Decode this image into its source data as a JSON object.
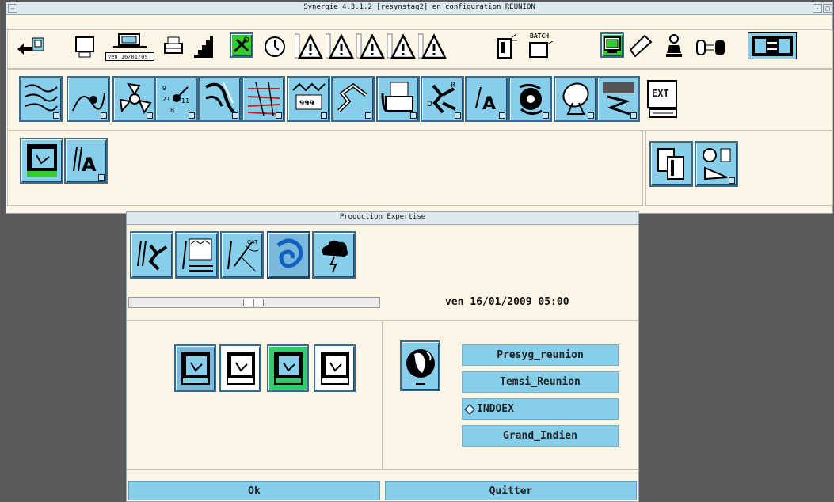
{
  "main_window": {
    "title": "Synergie 4.3.1.2 [resynstag2] en configuration REUNION",
    "date_display": "ven 16/01/09",
    "batch_label": "BATCH",
    "exit_label": "EXT",
    "toolbar_icons": [
      "back-icon",
      "screen-icon",
      "calendar-date-icon",
      "print-icon",
      "profile-icon",
      "green-tools-icon",
      "clock-icon",
      "warning-obs-icon",
      "warning-cum-icon",
      "warning-mes-icon",
      "warning-img-icon",
      "warning-alex-icon",
      "batch-doc-icon",
      "batch-icon",
      "green-monitor-icon",
      "eraser-icon",
      "person-icon",
      "swap-icon",
      "display-swap-icon"
    ],
    "accent_color": "#87ceeb",
    "green_color": "#33cc33"
  },
  "dialog": {
    "title": "Production Expertise",
    "date_label": "ven 16/01/2009 05:00",
    "list_items": [
      {
        "label": "Presyg_reunion",
        "selected": false
      },
      {
        "label": "Temsi_Reunion",
        "selected": false
      },
      {
        "label": "INDOEX",
        "selected": true
      },
      {
        "label": "Grand_Indien",
        "selected": false
      }
    ],
    "ok_label": "Ok",
    "quit_label": "Quitter",
    "slider_value": 0.45
  }
}
